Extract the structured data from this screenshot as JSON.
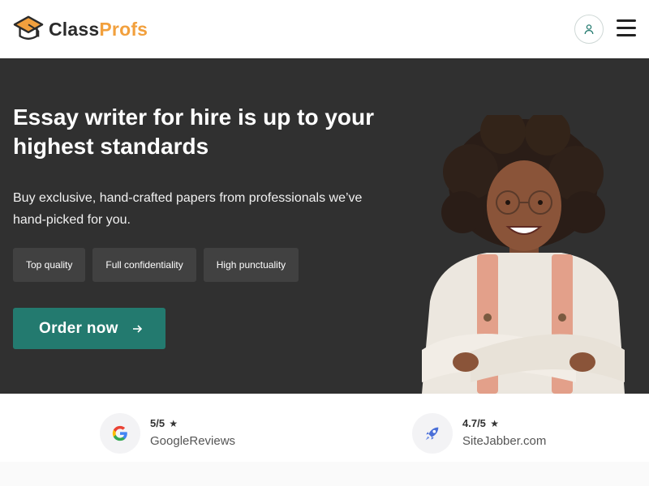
{
  "header": {
    "logo_part1": "Class",
    "logo_part2": "Profs"
  },
  "hero": {
    "title": "Essay writer for hire is up to your highest standards",
    "subtitle": "Buy exclusive, hand-crafted papers from professionals we’ve hand-picked for you.",
    "features": [
      "Top quality",
      "Full confidentiality",
      "High punctuality"
    ],
    "cta_label": "Order now"
  },
  "ratings": [
    {
      "score": "5/5",
      "source": "GoogleReviews",
      "icon": "google-icon"
    },
    {
      "score": "4.7/5",
      "source": "SiteJabber.com",
      "icon": "rocket-icon"
    }
  ],
  "colors": {
    "accent": "#237a6f",
    "brand_orange": "#f2a03d",
    "hero_bg": "#303030"
  }
}
